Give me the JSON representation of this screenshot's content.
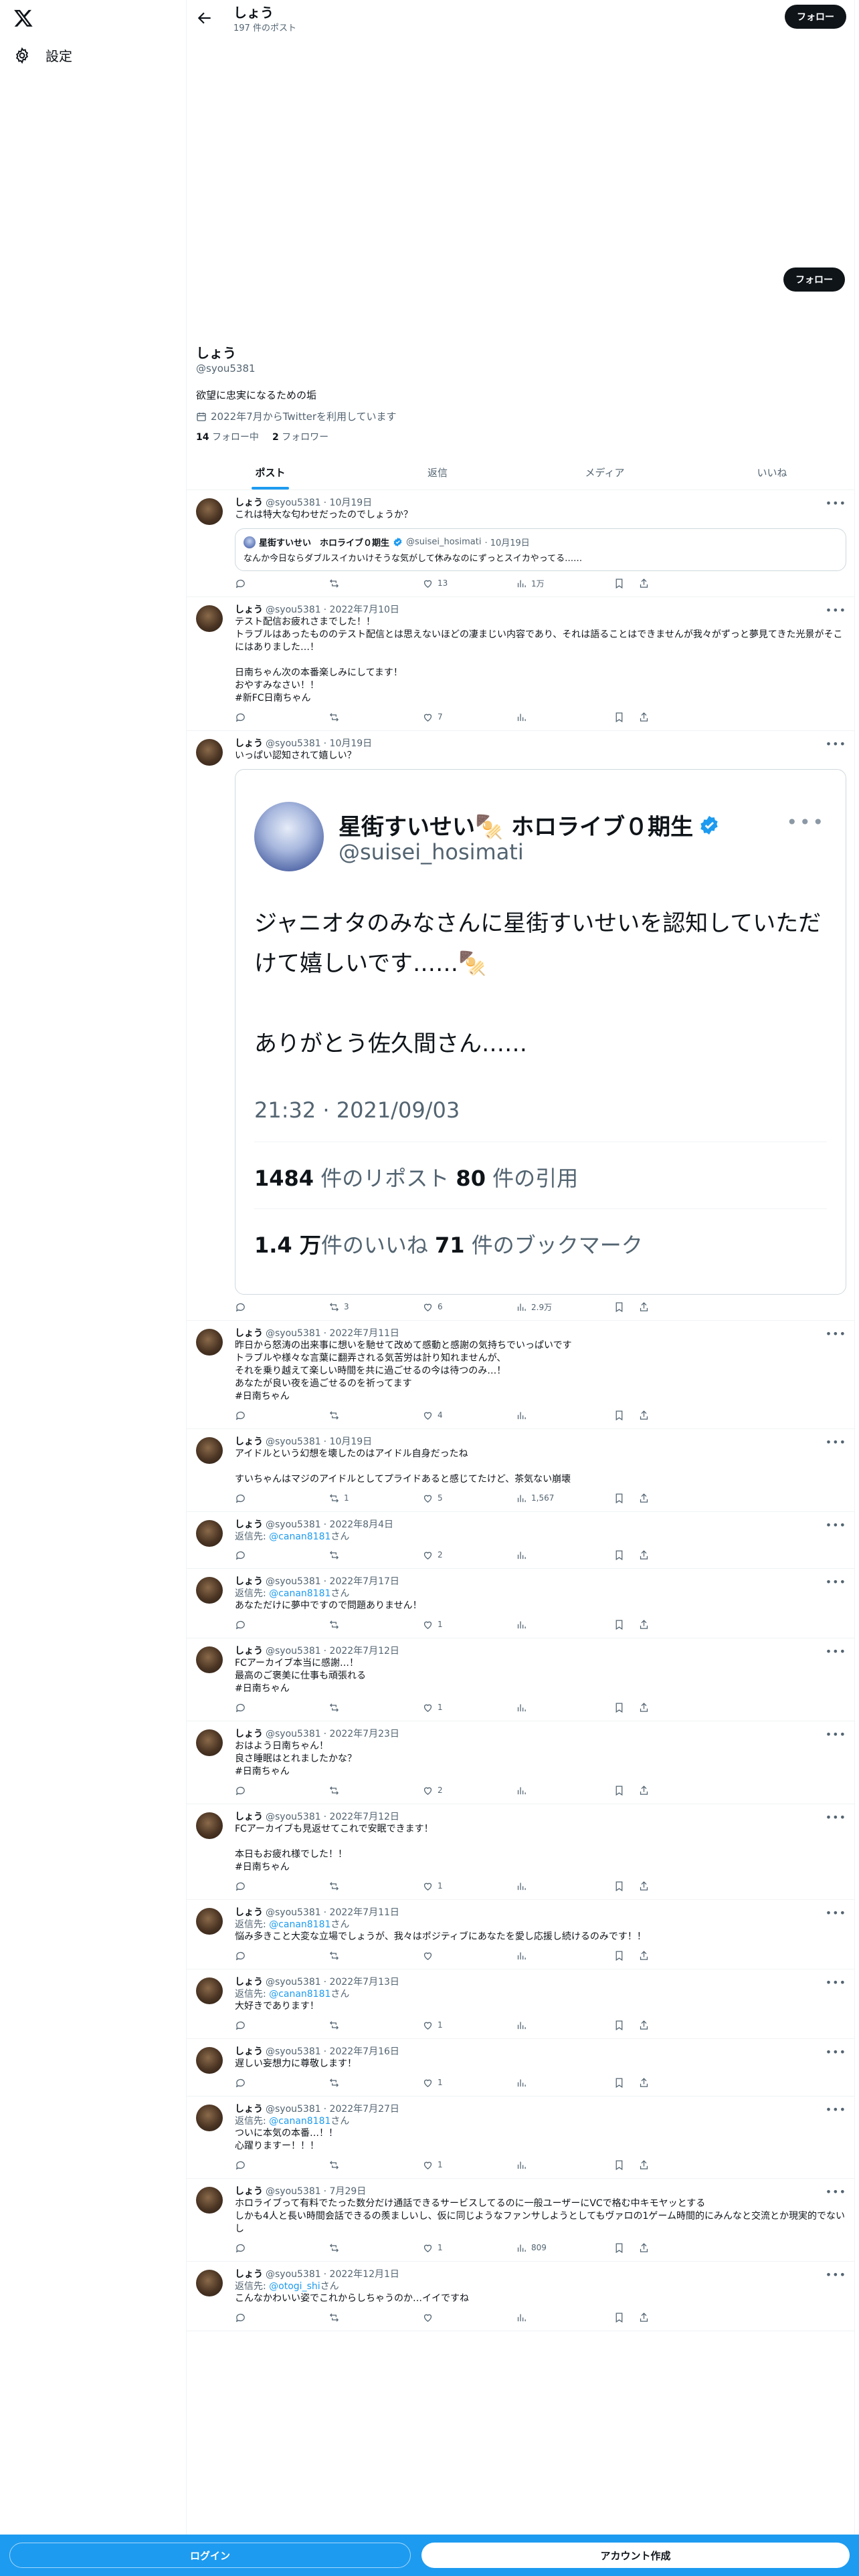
{
  "nav": {
    "settings_label": "設定"
  },
  "header": {
    "name": "しょう",
    "post_count": "197 件のポスト",
    "follow_label": "フォロー"
  },
  "profile": {
    "follow_label": "フォロー",
    "name": "しょう",
    "handle": "@syou5381",
    "bio": "欲望に忠実になるための垢",
    "joined": "2022年7月からTwitterを利用しています",
    "following_count": "14",
    "following_label": "フォロー中",
    "followers_count": "2",
    "followers_label": "フォロワー"
  },
  "tabs": [
    "ポスト",
    "返信",
    "メディア",
    "いいね"
  ],
  "quote1": {
    "name": "星街すいせい　ホロライブ０期生",
    "handle": "@suisei_hosimati",
    "date": "· 10月19日",
    "text": "なんか今日ならダブルスイカいけそうな気がして休みなのにずっとスイカやってる……"
  },
  "imgcard": {
    "name": "星街すいせい🍢 ホロライブ０期生",
    "handle": "@suisei_hosimati",
    "text": "ジャニオタのみなさんに星街すいせいを認知していただけて嬉しいです……🍢\n\nありがとう佐久間さん……",
    "time": "21:32 · 2021/09/03",
    "reposts_n": "1484",
    "reposts_l": " 件のリポスト",
    "quotes_n": "80",
    "quotes_l": " 件の引用",
    "likes_n": "1.4 万",
    "likes_l": "件のいいね",
    "bookmarks_n": "71",
    "bookmarks_l": " 件のブックマーク"
  },
  "tweets": [
    {
      "name": "しょう",
      "handle": "@syou5381",
      "date": "· 10月19日",
      "text": "これは特大な匂わせだったのでしょうか？",
      "reply_count": "",
      "repost_count": "",
      "like_count": "13",
      "view_count": "1万"
    },
    {
      "name": "しょう",
      "handle": "@syou5381",
      "date": "· 2022年7月10日",
      "text": "テスト配信お疲れさまでした！！\nトラブルはあったもののテスト配信とは思えないほどの凄まじい内容であり、それは語ることはできませんが我々がずっと夢見てきた光景がそこにはありました…！\n\n日南ちゃん次の本番楽しみにしてます！\nおやすみなさい！！",
      "hashtag": "#新FC日南ちゃん",
      "like_count": "7"
    },
    {
      "name": "しょう",
      "handle": "@syou5381",
      "date": "· 10月19日",
      "text": "いっぱい認知されて嬉しい？",
      "repost_count": "3",
      "like_count": "6",
      "view_count": "2.9万"
    },
    {
      "name": "しょう",
      "handle": "@syou5381",
      "date": "· 2022年7月11日",
      "text": "昨日から怒涛の出来事に想いを馳せて改めて感動と感謝の気持ちでいっぱいです\nトラブルや様々な言葉に翻弄される気苦労は計り知れませんが、\nそれを乗り越えて楽しい時間を共に過ごせるの今は待つのみ…！\nあなたが良い夜を過ごせるのを祈ってます",
      "hashtag": "#日南ちゃん",
      "like_count": "4"
    },
    {
      "name": "しょう",
      "handle": "@syou5381",
      "date": "· 10月19日",
      "text": "アイドルという幻想を壊したのはアイドル自身だったね\n\nすいちゃんはマジのアイドルとしてプライドあると感じてたけど、茶気ない崩壊",
      "repost_count": "1",
      "like_count": "5",
      "view_count": "1,567"
    },
    {
      "name": "しょう",
      "handle": "@syou5381",
      "date": "· 2022年8月4日",
      "reply_to": "@canan8181",
      "like_count": "2"
    },
    {
      "name": "しょう",
      "handle": "@syou5381",
      "date": "· 2022年7月17日",
      "reply_to": "@canan8181",
      "text": "あなただけに夢中ですので問題ありません！",
      "like_count": "1"
    },
    {
      "name": "しょう",
      "handle": "@syou5381",
      "date": "· 2022年7月12日",
      "text": "FCアーカイブ本当に感謝…！\n最高のご褒美に仕事も頑張れる",
      "hashtag": "#日南ちゃん",
      "like_count": "1"
    },
    {
      "name": "しょう",
      "handle": "@syou5381",
      "date": "· 2022年7月23日",
      "text": "おはよう日南ちゃん！\n良さ睡眠はとれましたかな？",
      "hashtag": "#日南ちゃん",
      "like_count": "2"
    },
    {
      "name": "しょう",
      "handle": "@syou5381",
      "date": "· 2022年7月12日",
      "text": "FCアーカイブも見返せてこれで安眠できます！\n\n本日もお疲れ様でした！！",
      "hashtag": "#日南ちゃん",
      "like_count": "1"
    },
    {
      "name": "しょう",
      "handle": "@syou5381",
      "date": "· 2022年7月11日",
      "reply_to": "@canan8181",
      "text": "悩み多きこと大変な立場でしょうが、我々はポジティブにあなたを愛し応援し続けるのみです！！"
    },
    {
      "name": "しょう",
      "handle": "@syou5381",
      "date": "· 2022年7月13日",
      "reply_to": "@canan8181",
      "text": "大好きであります！",
      "like_count": "1"
    },
    {
      "name": "しょう",
      "handle": "@syou5381",
      "date": "· 2022年7月16日",
      "text": "遅しい妄想力に尊敬します！",
      "like_count": "1"
    },
    {
      "name": "しょう",
      "handle": "@syou5381",
      "date": "· 2022年7月27日",
      "reply_to": "@canan8181",
      "text": "ついに本気の本番…！！\n心躍りますー！！！",
      "like_count": "1"
    },
    {
      "name": "しょう",
      "handle": "@syou5381",
      "date": "· 7月29日",
      "text": "ホロライブって有料でたった数分だけ通話できるサービスしてるのに一般ユーザーにVCで格む中キモヤッとする\nしかも4人と長い時間会話できるの羨ましいし、仮に同じようなファンサしようとしてもヴァロの1ゲーム時間的にみんなと交流とか現実的でないし",
      "like_count": "1",
      "view_count": "809"
    },
    {
      "name": "しょう",
      "handle": "@syou5381",
      "date": "· 2022年12月1日",
      "reply_to": "@otogi_shi",
      "text": "こんなかわいい姿でこれからしちゃうのか…イイですね"
    }
  ],
  "reply_prefix": "返信先: ",
  "reply_suffix": "さん",
  "bottom": {
    "login_label": "ログイン",
    "signup_label": "アカウント作成"
  }
}
